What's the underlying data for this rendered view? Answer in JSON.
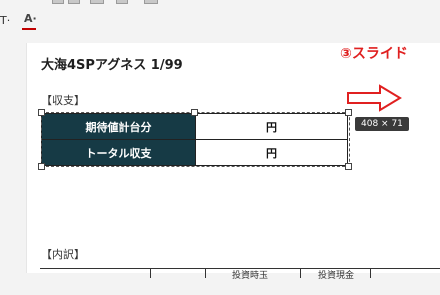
{
  "toolbar": {
    "text_t_label": "T·",
    "font_color_label": "A·"
  },
  "document": {
    "title": "大海4SPアグネス 1/99",
    "section_balance": "【収支】",
    "section_breakdown": "【内訳】",
    "rows": [
      {
        "label": "期待値計台分",
        "value": "円"
      },
      {
        "label": "トータル収支",
        "value": "円"
      }
    ],
    "breakdown_headers": [
      "投資時玉",
      "投資現金"
    ]
  },
  "annotation": {
    "slide_label": "③スライド",
    "size_tooltip": "408 × 71"
  },
  "colors": {
    "header_fill": "#163a45",
    "annotation_red": "#e02020"
  }
}
